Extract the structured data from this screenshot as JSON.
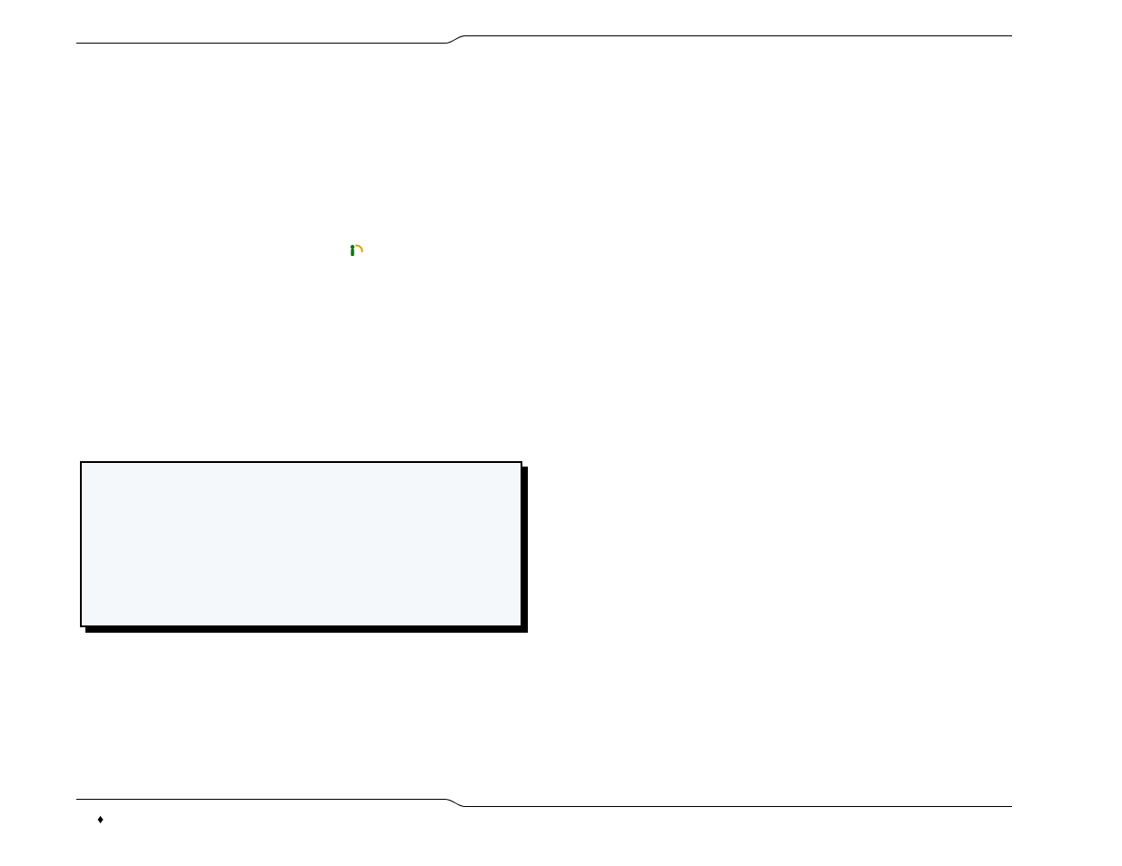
{
  "icons": {
    "inline_icon_name": "decorative-inline-icon"
  },
  "footer": {
    "bullet_glyph": "♦"
  }
}
